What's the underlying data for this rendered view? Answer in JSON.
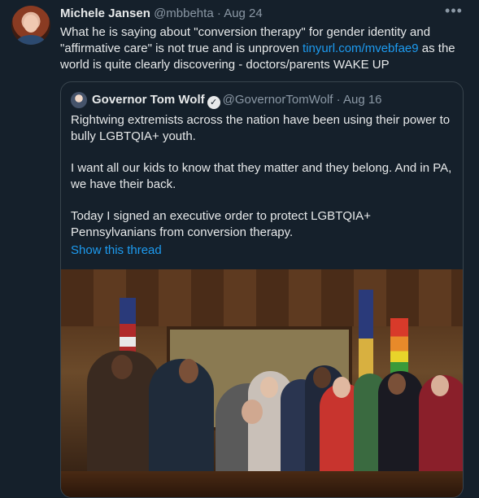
{
  "tweet": {
    "author_name": "Michele Jansen",
    "handle": "@mbbehta",
    "separator": "·",
    "date": "Aug 24",
    "more_icon": "more-icon",
    "text_before_link": "What he is saying about \"conversion therapy\" for gender identity and \"affirmative care\" is not true and is unproven ",
    "link_text": "tinyurl.com/mvebfae9",
    "text_after_link": " as the world is quite clearly discovering - doctors/parents WAKE UP"
  },
  "quoted": {
    "author_name": "Governor Tom Wolf",
    "handle": "@GovernorTomWolf",
    "separator": "·",
    "date": "Aug 16",
    "verified_icon": "verified-badge-icon",
    "paragraphs": [
      "Rightwing extremists across the nation have been using their power to bully LGBTQIA+ youth.",
      "I want all our kids to know that they matter and they belong. And in PA, we have their back.",
      "Today I signed an executive order to protect LGBTQIA+ Pennsylvanians from conversion therapy."
    ],
    "show_thread": "Show this thread"
  },
  "colors": {
    "background": "#15202b",
    "text": "#e7e9ea",
    "muted": "#8b98a5",
    "link": "#1d9bf0",
    "border": "#38444d"
  }
}
